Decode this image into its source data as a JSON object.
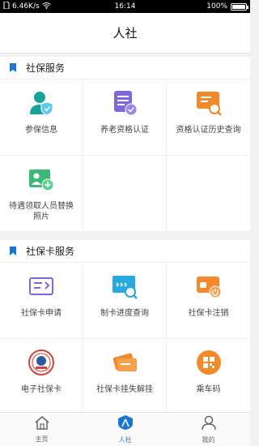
{
  "status_bar": {
    "speed": "6.46K/s",
    "time": "16:14",
    "battery": "100%"
  },
  "header": {
    "title": "人社"
  },
  "sections": [
    {
      "title": "社保服务",
      "items": [
        {
          "label": "参保信息",
          "icon": "user-shield-icon"
        },
        {
          "label": "养老资格认证",
          "icon": "certificate-check-icon"
        },
        {
          "label": "资格认证历史查询",
          "icon": "history-search-icon"
        },
        {
          "label": "待遇领取人员替换照片",
          "icon": "photo-replace-icon"
        }
      ]
    },
    {
      "title": "社保卡服务",
      "items": [
        {
          "label": "社保卡申请",
          "icon": "card-apply-icon"
        },
        {
          "label": "制卡进度查询",
          "icon": "progress-search-icon"
        },
        {
          "label": "社保卡注销",
          "icon": "card-cancel-icon"
        },
        {
          "label": "电子社保卡",
          "icon": "ecard-seal-icon"
        },
        {
          "label": "社保卡挂失解挂",
          "icon": "card-lost-icon"
        },
        {
          "label": "乘车码",
          "icon": "qr-code-icon"
        }
      ]
    }
  ],
  "tabs": [
    {
      "label": "主页",
      "icon": "home-icon"
    },
    {
      "label": "人社",
      "icon": "hr-icon"
    },
    {
      "label": "我的",
      "icon": "profile-icon"
    }
  ],
  "colors": {
    "accent": "#1976d2",
    "green": "#16a39a",
    "purple": "#7e67d8",
    "orange": "#f28a2c",
    "cyan": "#29a9e0"
  }
}
